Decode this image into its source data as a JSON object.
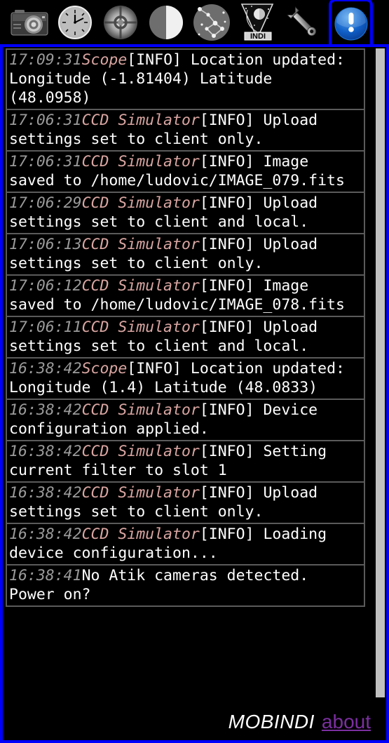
{
  "theme": {
    "accent_blue": "#0000ff",
    "background": "#000000",
    "entry_border": "#5a5a5a",
    "timestamp_color": "#9a9a9a",
    "device_color": "#d9a6a2",
    "message_color": "#ffffff",
    "scrollbar_color": "#c0c0c0",
    "link_color": "#7b2fa0"
  },
  "toolbar": {
    "items": [
      {
        "icon": "camera-icon",
        "label": "Camera",
        "selected": false
      },
      {
        "icon": "clock-icon",
        "label": "Clock",
        "selected": false
      },
      {
        "icon": "focuser-icon",
        "label": "Focuser",
        "selected": false
      },
      {
        "icon": "moon-phase-icon",
        "label": "Moon Phase",
        "selected": false
      },
      {
        "icon": "constellation-icon",
        "label": "Sky Map",
        "selected": false
      },
      {
        "icon": "indi-telescope-icon",
        "label": "INDI",
        "selected": false
      },
      {
        "icon": "wrench-icon",
        "label": "Settings",
        "selected": false
      },
      {
        "icon": "notifications-icon",
        "label": "Messages",
        "selected": true
      }
    ]
  },
  "log": {
    "entries": [
      {
        "time": "17:09:31",
        "device": "Scope",
        "message": "[INFO] Location updated: Longitude (-1.81404) Latitude (48.0958)"
      },
      {
        "time": "17:06:31",
        "device": "CCD Simulator",
        "message": "[INFO] Upload settings set to client only."
      },
      {
        "time": "17:06:31",
        "device": "CCD Simulator",
        "message": "[INFO] Image saved to /home/ludovic/IMAGE_079.fits"
      },
      {
        "time": "17:06:29",
        "device": "CCD Simulator",
        "message": "[INFO] Upload settings set to client and local."
      },
      {
        "time": "17:06:13",
        "device": "CCD Simulator",
        "message": "[INFO] Upload settings set to client only."
      },
      {
        "time": "17:06:12",
        "device": "CCD Simulator",
        "message": "[INFO] Image saved to /home/ludovic/IMAGE_078.fits"
      },
      {
        "time": "17:06:11",
        "device": "CCD Simulator",
        "message": "[INFO] Upload settings set to client and local."
      },
      {
        "time": "16:38:42",
        "device": "Scope",
        "message": "[INFO] Location updated: Longitude (1.4) Latitude (48.0833)"
      },
      {
        "time": "16:38:42",
        "device": "CCD Simulator",
        "message": "[INFO] Device configuration applied."
      },
      {
        "time": "16:38:42",
        "device": "CCD Simulator",
        "message": "[INFO] Setting current filter to slot 1"
      },
      {
        "time": "16:38:42",
        "device": "CCD Simulator",
        "message": "[INFO] Upload settings set to client only."
      },
      {
        "time": "16:38:42",
        "device": "CCD Simulator",
        "message": "[INFO] Loading device configuration..."
      },
      {
        "time": "16:38:41",
        "device": "",
        "message": "No Atik cameras detected. Power on?"
      }
    ]
  },
  "footer": {
    "brand": "MOBINDI",
    "about_label": "about"
  }
}
